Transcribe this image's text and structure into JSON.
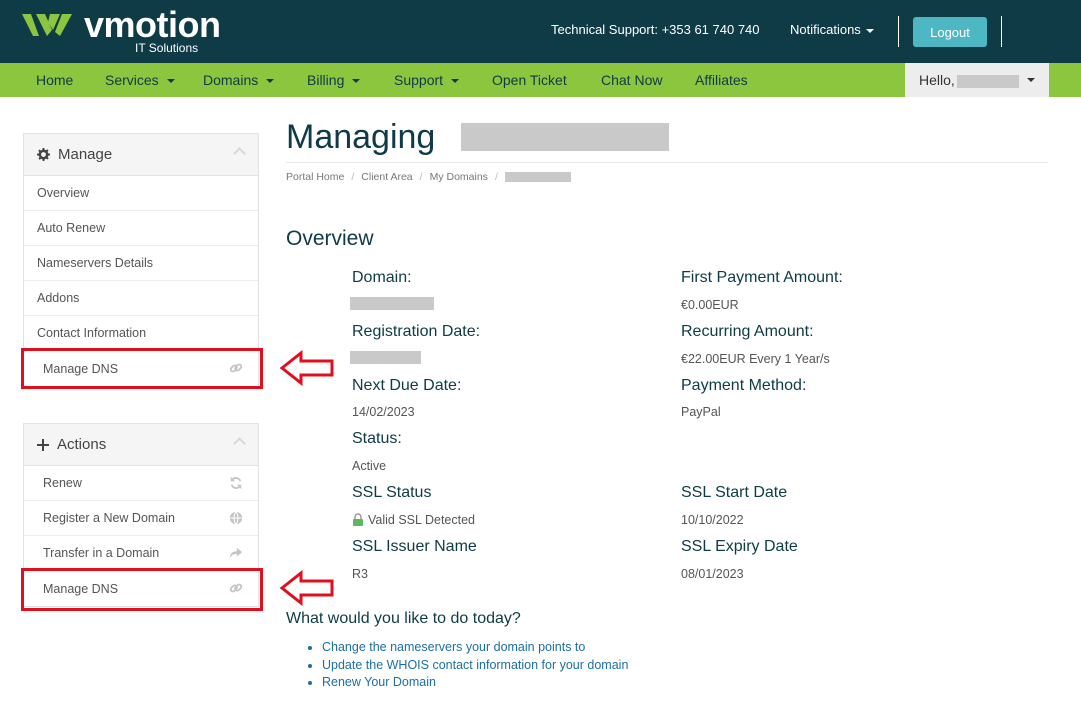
{
  "header": {
    "brand": "vmotion",
    "brand_sub": "IT Solutions",
    "tech_support": "Technical Support: +353 61 740 740",
    "notifications": "Notifications",
    "logout": "Logout"
  },
  "nav": {
    "items": [
      {
        "label": "Home",
        "dropdown": false
      },
      {
        "label": "Services",
        "dropdown": true
      },
      {
        "label": "Domains",
        "dropdown": true
      },
      {
        "label": "Billing",
        "dropdown": true
      },
      {
        "label": "Support",
        "dropdown": true
      },
      {
        "label": "Open Ticket",
        "dropdown": false
      },
      {
        "label": "Chat Now",
        "dropdown": false
      },
      {
        "label": "Affiliates",
        "dropdown": false
      }
    ],
    "hello": "Hello,"
  },
  "sidebar": {
    "manage": {
      "title": "Manage",
      "icon": "gear-icon",
      "items": [
        {
          "label": "Overview"
        },
        {
          "label": "Auto Renew"
        },
        {
          "label": "Nameservers Details"
        },
        {
          "label": "Addons"
        },
        {
          "label": "Contact Information"
        },
        {
          "label": "Manage DNS",
          "icon": "link-icon"
        }
      ]
    },
    "actions": {
      "title": "Actions",
      "icon": "plus-icon",
      "items": [
        {
          "label": "Renew",
          "icon": "refresh-icon"
        },
        {
          "label": "Register a New Domain",
          "icon": "globe-icon"
        },
        {
          "label": "Transfer in a Domain",
          "icon": "share-icon"
        },
        {
          "label": "Manage DNS",
          "icon": "link-icon"
        }
      ]
    }
  },
  "main": {
    "title": "Managing",
    "breadcrumb": [
      "Portal Home",
      "Client Area",
      "My Domains"
    ],
    "overview_heading": "Overview",
    "fields": {
      "domain_label": "Domain:",
      "first_payment_label": "First Payment Amount:",
      "first_payment_value": "€0.00EUR",
      "registration_label": "Registration Date:",
      "recurring_label": "Recurring Amount:",
      "recurring_value": "€22.00EUR Every 1 Year/s",
      "next_due_label": "Next Due Date:",
      "next_due_value": "14/02/2023",
      "payment_method_label": "Payment Method:",
      "payment_method_value": "PayPal",
      "status_label": "Status:",
      "status_value": "Active",
      "ssl_status_label": "SSL Status",
      "ssl_status_value": "Valid SSL Detected",
      "ssl_start_label": "SSL Start Date",
      "ssl_start_value": "10/10/2022",
      "ssl_issuer_label": "SSL Issuer Name",
      "ssl_issuer_value": "R3",
      "ssl_expiry_label": "SSL Expiry Date",
      "ssl_expiry_value": "08/01/2023"
    },
    "todo_heading": "What would you like to do today?",
    "todo_links": [
      "Change the nameservers your domain points to",
      "Update the WHOIS contact information for your domain",
      "Renew Your Domain"
    ]
  },
  "colors": {
    "header_bg": "#0e3b46",
    "nav_bg": "#8cc63f",
    "logout_bg": "#4db8c3",
    "annotation_red": "#e00f1f",
    "link": "#1c6fa3"
  }
}
